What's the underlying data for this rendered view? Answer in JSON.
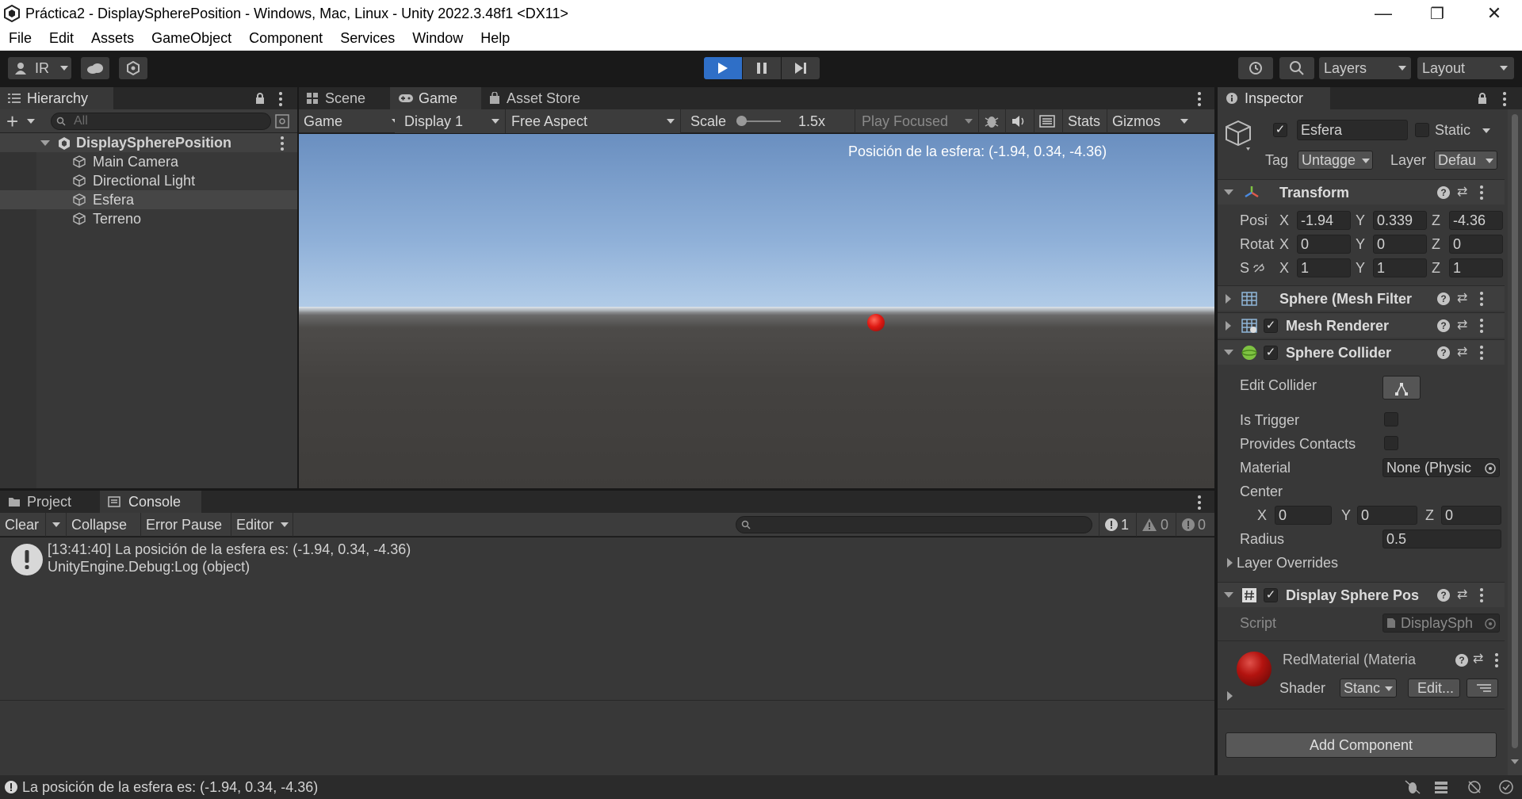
{
  "window": {
    "title": "Práctica2 - DisplaySpherePosition - Windows, Mac, Linux - Unity 2022.3.48f1 <DX11>",
    "minimize": "—",
    "maximize": "❐",
    "close": "✕"
  },
  "menu": [
    "File",
    "Edit",
    "Assets",
    "GameObject",
    "Component",
    "Services",
    "Window",
    "Help"
  ],
  "toolbar": {
    "account_label": "IR",
    "layers_label": "Layers",
    "layout_label": "Layout"
  },
  "hierarchy": {
    "tab_label": "Hierarchy",
    "search_placeholder": "All",
    "scene_name": "DisplaySpherePosition",
    "items": [
      "Main Camera",
      "Directional Light",
      "Esfera",
      "Terreno"
    ],
    "selected": "Esfera"
  },
  "game_view": {
    "tabs": [
      "Scene",
      "Game",
      "Asset Store"
    ],
    "active_tab": "Game",
    "display_mode": "Game",
    "display": "Display 1",
    "aspect": "Free Aspect",
    "scale_label": "Scale",
    "scale_value": "1.5x",
    "play_mode": "Play Focused",
    "stats_label": "Stats",
    "gizmos_label": "Gizmos",
    "overlay_text": "Posición de la esfera: (-1.94, 0.34, -4.36)",
    "sphere_color": "#e01a14"
  },
  "console": {
    "tabs": [
      "Project",
      "Console"
    ],
    "active_tab": "Console",
    "clear_label": "Clear",
    "collapse_label": "Collapse",
    "error_pause_label": "Error Pause",
    "editor_label": "Editor",
    "count_log": "1",
    "count_warn": "0",
    "count_error": "0",
    "entries": [
      {
        "line1": "[13:41:40] La posición de la esfera es: (-1.94, 0.34, -4.36)",
        "line2": "UnityEngine.Debug:Log (object)"
      }
    ]
  },
  "inspector": {
    "tab_label": "Inspector",
    "object_name": "Esfera",
    "static_label": "Static",
    "tag_label": "Tag",
    "tag_value": "Untagge",
    "layer_label": "Layer",
    "layer_value": "Defau",
    "transform": {
      "title": "Transform",
      "position_label": "Positi",
      "rotation_label": "Rotat",
      "scale_label": "S",
      "position": {
        "x": "-1.94",
        "y": "0.339",
        "z": "-4.36"
      },
      "rotation": {
        "x": "0",
        "y": "0",
        "z": "0"
      },
      "scale": {
        "x": "1",
        "y": "1",
        "z": "1"
      }
    },
    "axis": {
      "x": "X",
      "y": "Y",
      "z": "Z"
    },
    "mesh_filter": {
      "title": "Sphere (Mesh Filter"
    },
    "mesh_renderer": {
      "title": "Mesh Renderer"
    },
    "sphere_collider": {
      "title": "Sphere Collider",
      "edit_collider_label": "Edit Collider",
      "is_trigger_label": "Is Trigger",
      "provides_contacts_label": "Provides Contacts",
      "material_label": "Material",
      "material_value": "None (Physic",
      "center_label": "Center",
      "center": {
        "x": "0",
        "y": "0",
        "z": "0"
      },
      "radius_label": "Radius",
      "radius_value": "0.5",
      "layer_overrides_label": "Layer Overrides"
    },
    "script_component": {
      "title": "Display Sphere Pos",
      "script_label": "Script",
      "script_value": "DisplaySph"
    },
    "material": {
      "name": "RedMaterial (Materia",
      "shader_label": "Shader",
      "shader_value": "Stanc",
      "edit_label": "Edit..."
    },
    "add_component_label": "Add Component"
  },
  "status_bar": {
    "message": "La posición de la esfera es: (-1.94, 0.34, -4.36)"
  }
}
